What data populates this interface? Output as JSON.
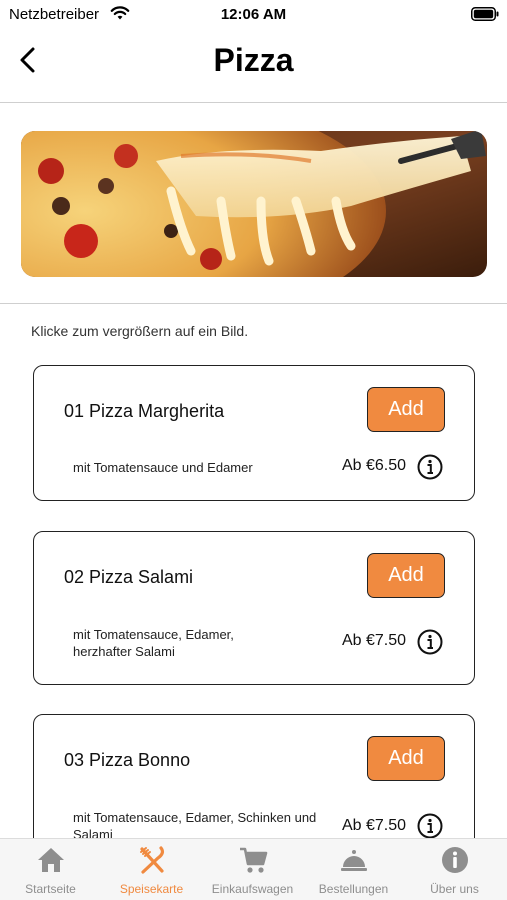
{
  "status": {
    "carrier": "Netzbetreiber",
    "time": "12:06 AM"
  },
  "nav": {
    "title": "Pizza"
  },
  "hint": "Klicke zum vergrößern auf ein Bild.",
  "items": [
    {
      "name": "01 Pizza Margherita",
      "description": "mit Tomatensauce und Edamer",
      "price": "Ab €6.50",
      "add_label": "Add"
    },
    {
      "name": "02 Pizza Salami",
      "description": "mit Tomatensauce, Edamer, herzhafter Salami",
      "price": "Ab €7.50",
      "add_label": "Add"
    },
    {
      "name": "03 Pizza Bonno",
      "description": "mit Tomatensauce, Edamer, Schinken und Salami",
      "price": "Ab €7.50",
      "add_label": "Add"
    }
  ],
  "tabs": [
    {
      "label": "Startseite",
      "icon": "home-icon",
      "active": false
    },
    {
      "label": "Speisekarte",
      "icon": "fork-knife-icon",
      "active": true
    },
    {
      "label": "Einkaufswagen",
      "icon": "cart-icon",
      "active": false
    },
    {
      "label": "Bestellungen",
      "icon": "cloche-icon",
      "active": false
    },
    {
      "label": "Über uns",
      "icon": "info-icon",
      "active": false
    }
  ],
  "colors": {
    "accent": "#f08a40",
    "tab_inactive": "#8e8e8e",
    "card_border": "#222222"
  }
}
